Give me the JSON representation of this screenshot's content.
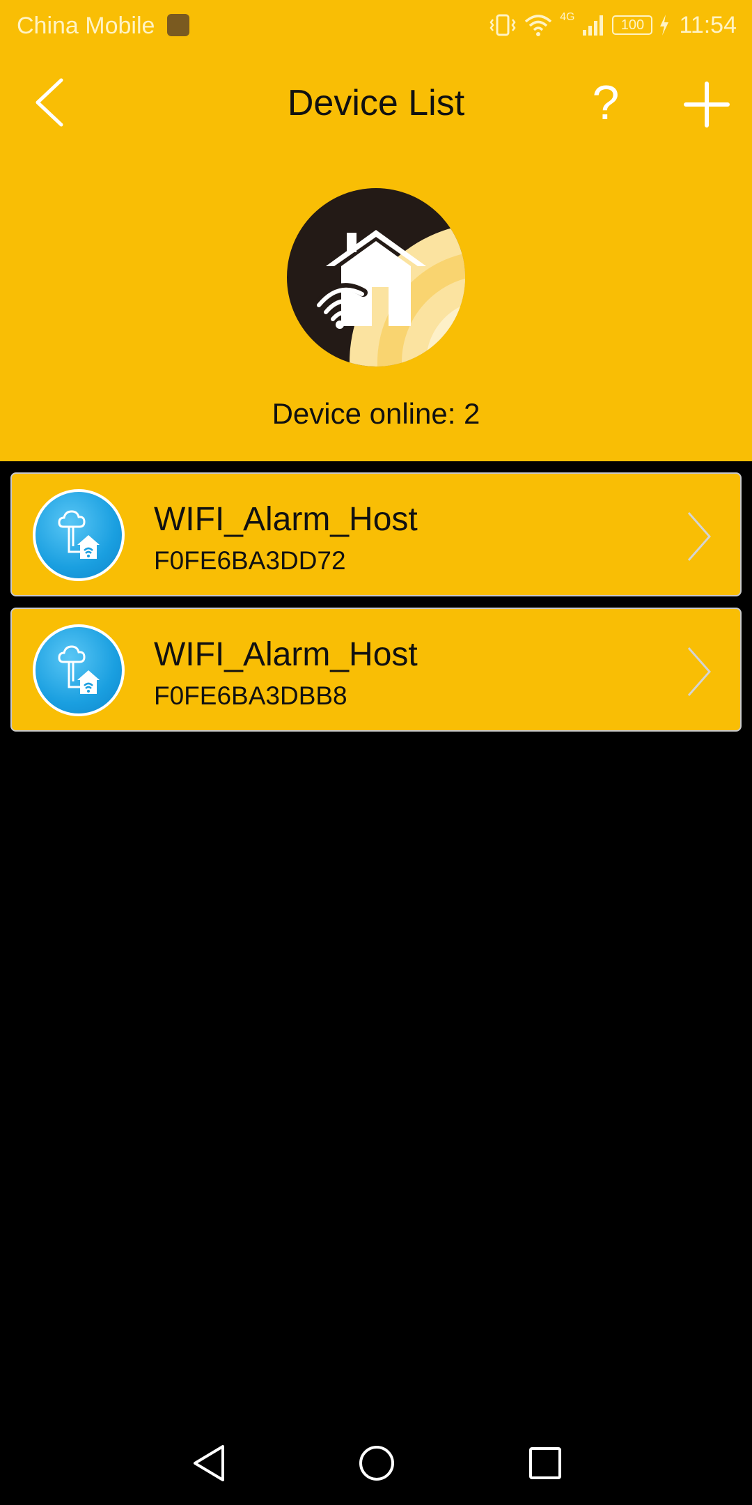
{
  "status_bar": {
    "carrier": "China Mobile",
    "network": "4G",
    "battery": "100",
    "time": "11:54"
  },
  "app_bar": {
    "title": "Device List",
    "help_label": "?"
  },
  "summary": {
    "online_text": "Device online: 2"
  },
  "devices": [
    {
      "name": "WIFI_Alarm_Host",
      "id": "F0FE6BA3DD72"
    },
    {
      "name": "WIFI_Alarm_Host",
      "id": "F0FE6BA3DBB8"
    }
  ],
  "colors": {
    "accent": "#F9BE05",
    "background": "#000000",
    "avatar_blue": "#1a9fe0"
  },
  "icons": {
    "back": "chevron-left-icon",
    "help": "question-icon",
    "add": "plus-icon",
    "hero": "home-wifi-icon",
    "device": "cloud-home-wifi-icon",
    "row_arrow": "chevron-right-icon"
  }
}
